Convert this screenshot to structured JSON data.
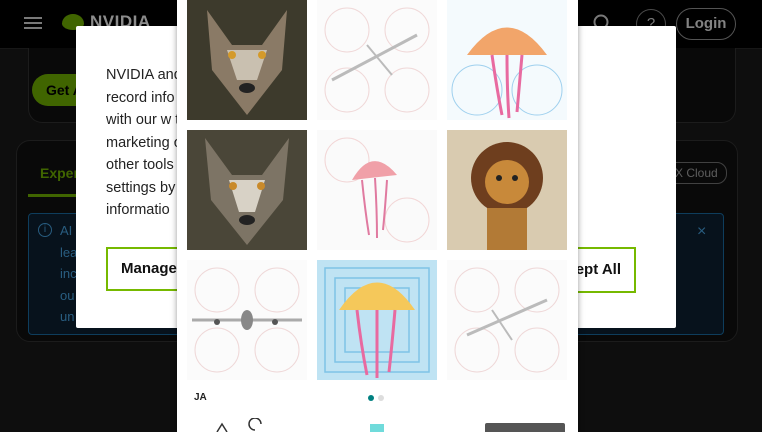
{
  "header": {
    "brand": "NVIDIA",
    "help_label": "?",
    "login_label": "Login"
  },
  "hero": {
    "get_button_label": "Get A"
  },
  "tabs": {
    "active_label": "Exper",
    "badge_label": "X Cloud"
  },
  "info_banner": {
    "icon_glyph": "i",
    "lines": [
      "AI",
      "lea",
      "inc",
      "ou",
      "un"
    ],
    "close_glyph": "×"
  },
  "cookie_dialog": {
    "lines": [
      "NVIDIA and                                                                        ect and",
      "record info                                                                       nctions",
      "with our w                                                                          t in our",
      "marketing                                                                       okies and",
      "other tools                                                                     kie",
      "settings by                                                                      for more",
      "informatio"
    ],
    "manage_label": "Manage",
    "accept_label": "ept All"
  },
  "captcha": {
    "language": "JA",
    "pager": {
      "total": 2,
      "active": 1
    },
    "tiles": [
      {
        "subject": "wolf"
      },
      {
        "subject": "airplane"
      },
      {
        "subject": "jellyfish"
      },
      {
        "subject": "wolf"
      },
      {
        "subject": "jellyfish"
      },
      {
        "subject": "lion"
      },
      {
        "subject": "airplane"
      },
      {
        "subject": "jellyfish"
      },
      {
        "subject": "airplane"
      }
    ],
    "colors": {
      "accent": "#008080",
      "dot_inactive": "#dddddd"
    }
  },
  "colors": {
    "brand": "#76b900",
    "info": "#4aa8e8"
  }
}
